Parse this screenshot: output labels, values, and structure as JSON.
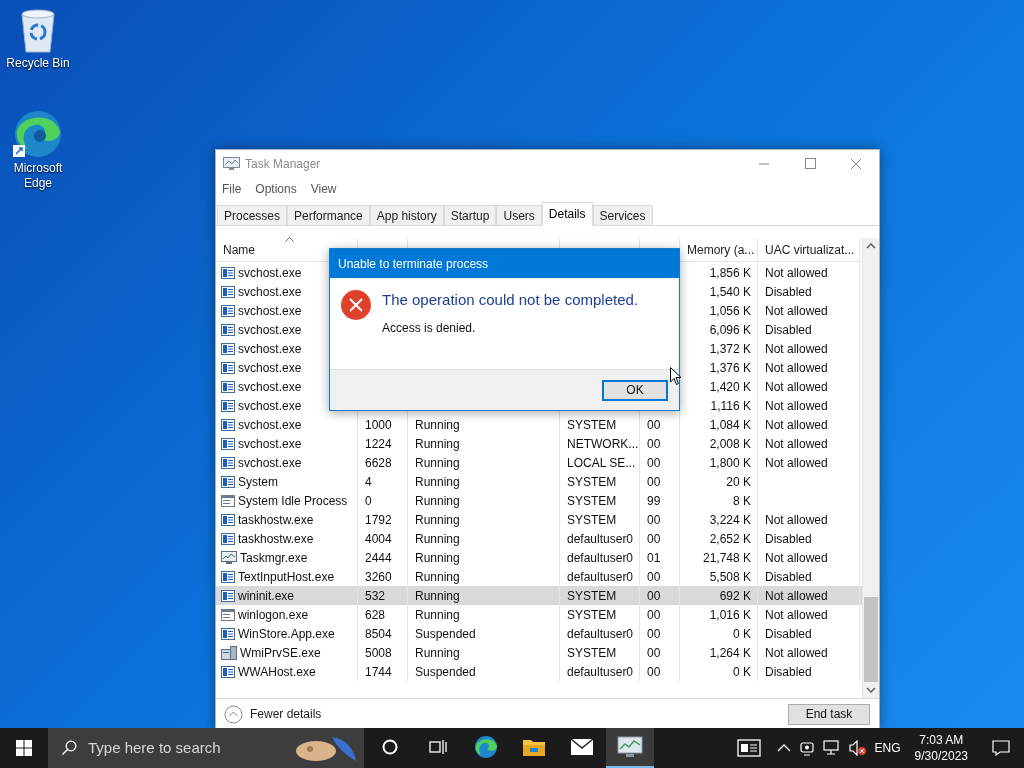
{
  "desktop_icons": [
    {
      "label": "Recycle Bin",
      "kind": "recycle"
    },
    {
      "label": "Microsoft Edge",
      "kind": "edge"
    }
  ],
  "window": {
    "title": "Task Manager",
    "active": false,
    "menu": [
      "File",
      "Options",
      "View"
    ],
    "tabs": [
      {
        "label": "Processes",
        "selected": false
      },
      {
        "label": "Performance",
        "selected": false
      },
      {
        "label": "App history",
        "selected": false
      },
      {
        "label": "Startup",
        "selected": false
      },
      {
        "label": "Users",
        "selected": false
      },
      {
        "label": "Details",
        "selected": true
      },
      {
        "label": "Services",
        "selected": false
      }
    ],
    "columns": {
      "name": "Name",
      "memory": "Memory (a...",
      "uac": "UAC virtualizat..."
    },
    "rows": [
      {
        "kind": "app",
        "name": "svchost.exe",
        "memory": "1,856 K",
        "uac": "Not allowed",
        "selected": false
      },
      {
        "kind": "app",
        "name": "svchost.exe",
        "memory": "1,540 K",
        "uac": "Disabled",
        "selected": false
      },
      {
        "kind": "app",
        "name": "svchost.exe",
        "memory": "1,056 K",
        "uac": "Not allowed",
        "selected": false
      },
      {
        "kind": "app",
        "name": "svchost.exe",
        "memory": "6,096 K",
        "uac": "Disabled",
        "selected": false
      },
      {
        "kind": "app",
        "name": "svchost.exe",
        "memory": "1,372 K",
        "uac": "Not allowed",
        "selected": false
      },
      {
        "kind": "app",
        "name": "svchost.exe",
        "memory": "1,376 K",
        "uac": "Not allowed",
        "selected": false
      },
      {
        "kind": "app",
        "name": "svchost.exe",
        "memory": "1,420 K",
        "uac": "Not allowed",
        "selected": false
      },
      {
        "kind": "app",
        "name": "svchost.exe",
        "memory": "1,116 K",
        "uac": "Not allowed",
        "selected": false
      },
      {
        "kind": "app",
        "name": "svchost.exe",
        "pid": "1000",
        "status": "Running",
        "user": "SYSTEM",
        "cpu": "00",
        "memory": "1,084 K",
        "uac": "Not allowed",
        "selected": false
      },
      {
        "kind": "app",
        "name": "svchost.exe",
        "pid": "1224",
        "status": "Running",
        "user": "NETWORK...",
        "cpu": "00",
        "memory": "2,008 K",
        "uac": "Not allowed",
        "selected": false
      },
      {
        "kind": "app",
        "name": "svchost.exe",
        "pid": "6628",
        "status": "Running",
        "user": "LOCAL SE...",
        "cpu": "00",
        "memory": "1,800 K",
        "uac": "Not allowed",
        "selected": false
      },
      {
        "kind": "app",
        "name": "System",
        "pid": "4",
        "status": "Running",
        "user": "SYSTEM",
        "cpu": "00",
        "memory": "20 K",
        "selected": false
      },
      {
        "kind": "window",
        "name": "System Idle Process",
        "pid": "0",
        "status": "Running",
        "user": "SYSTEM",
        "cpu": "99",
        "memory": "8 K",
        "selected": false
      },
      {
        "kind": "app",
        "name": "taskhostw.exe",
        "pid": "1792",
        "status": "Running",
        "user": "SYSTEM",
        "cpu": "00",
        "memory": "3,224 K",
        "uac": "Not allowed",
        "selected": false
      },
      {
        "kind": "app",
        "name": "taskhostw.exe",
        "pid": "4004",
        "status": "Running",
        "user": "defaultuser0",
        "cpu": "00",
        "memory": "2,652 K",
        "uac": "Disabled",
        "selected": false
      },
      {
        "kind": "monitor",
        "name": "Taskmgr.exe",
        "pid": "2444",
        "status": "Running",
        "user": "defaultuser0",
        "cpu": "01",
        "memory": "21,748 K",
        "uac": "Not allowed",
        "selected": false
      },
      {
        "kind": "app",
        "name": "TextInputHost.exe",
        "pid": "3260",
        "status": "Running",
        "user": "defaultuser0",
        "cpu": "00",
        "memory": "5,508 K",
        "uac": "Disabled",
        "selected": false
      },
      {
        "kind": "app",
        "name": "wininit.exe",
        "pid": "532",
        "status": "Running",
        "user": "SYSTEM",
        "cpu": "00",
        "memory": "692 K",
        "uac": "Not allowed",
        "selected": true
      },
      {
        "kind": "window",
        "name": "winlogon.exe",
        "pid": "628",
        "status": "Running",
        "user": "SYSTEM",
        "cpu": "00",
        "memory": "1,016 K",
        "uac": "Not allowed",
        "selected": false
      },
      {
        "kind": "app",
        "name": "WinStore.App.exe",
        "pid": "8504",
        "status": "Suspended",
        "user": "defaultuser0",
        "cpu": "00",
        "memory": "0 K",
        "uac": "Disabled",
        "selected": false
      },
      {
        "kind": "computer",
        "name": "WmiPrvSE.exe",
        "pid": "5008",
        "status": "Running",
        "user": "SYSTEM",
        "cpu": "00",
        "memory": "1,264 K",
        "uac": "Not allowed",
        "selected": false
      },
      {
        "kind": "app",
        "name": "WWAHost.exe",
        "pid": "1744",
        "status": "Suspended",
        "user": "defaultuser0",
        "cpu": "00",
        "memory": "0 K",
        "uac": "Disabled",
        "selected": false
      }
    ],
    "fewer_details": "Fewer details",
    "end_task": "End task"
  },
  "dialog": {
    "title": "Unable to terminate process",
    "heading": "The operation could not be completed.",
    "message": "Access is denied.",
    "button": "OK"
  },
  "taskbar": {
    "search_placeholder": "Type here to search",
    "apps": [
      {
        "kind": "cortana",
        "active": false
      },
      {
        "kind": "taskview",
        "active": false
      },
      {
        "kind": "edge",
        "active": false
      },
      {
        "kind": "explorer",
        "active": false
      },
      {
        "kind": "mail",
        "active": false
      },
      {
        "kind": "taskmgr",
        "active": true
      }
    ],
    "language": "ENG",
    "time": "7:03 AM",
    "date": "9/30/2023"
  }
}
